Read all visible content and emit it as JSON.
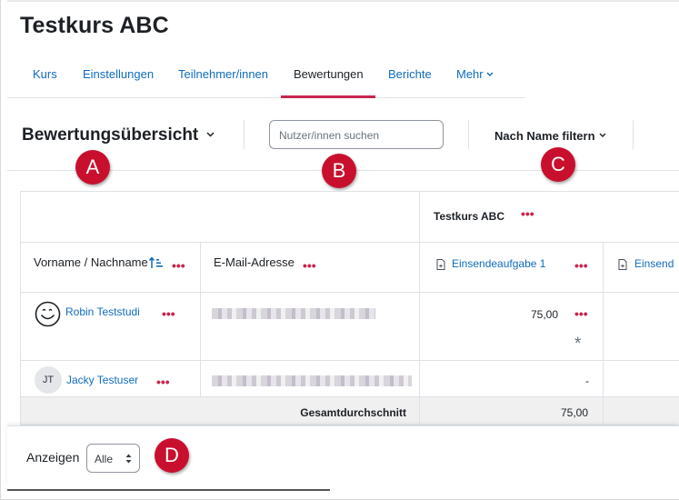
{
  "page": {
    "course_title": "Testkurs ABC"
  },
  "nav": {
    "tabs": [
      {
        "label": "Kurs"
      },
      {
        "label": "Einstellungen"
      },
      {
        "label": "Teilnehmer/innen"
      },
      {
        "label": "Bewertungen"
      },
      {
        "label": "Berichte"
      },
      {
        "label": "Mehr"
      }
    ],
    "active_tab": "Bewertungen",
    "more_chevron": "⌄"
  },
  "toolbar": {
    "report_selector_label": "Bewertungsübersicht",
    "search_placeholder": "Nutzer/innen suchen",
    "filter_label": "Nach Name filtern"
  },
  "markers": {
    "a": "A",
    "b": "B",
    "c": "C",
    "d": "D"
  },
  "grid": {
    "category_header": "Testkurs ABC",
    "columns": {
      "name": "Vorname / Nachname",
      "email": "E-Mail-Adresse",
      "assignment1": "Einsendeaufgabe 1",
      "assignment2": "Einsend"
    },
    "actions_glyph": "•••",
    "rows": [
      {
        "name": "Robin Teststudi",
        "grade": "75,00",
        "overridden_marker": "*"
      },
      {
        "name": "Jacky Testuser",
        "avatar_initials": "JT",
        "grade": "-"
      }
    ],
    "average_row": {
      "label": "Gesamtdurchschnitt",
      "value": "75,00"
    }
  },
  "footer": {
    "show_label": "Anzeigen",
    "per_page_value": "Alle"
  },
  "colors": {
    "accent": "#c7254e",
    "link": "#0f6cbf",
    "marker": "#c8102e"
  }
}
